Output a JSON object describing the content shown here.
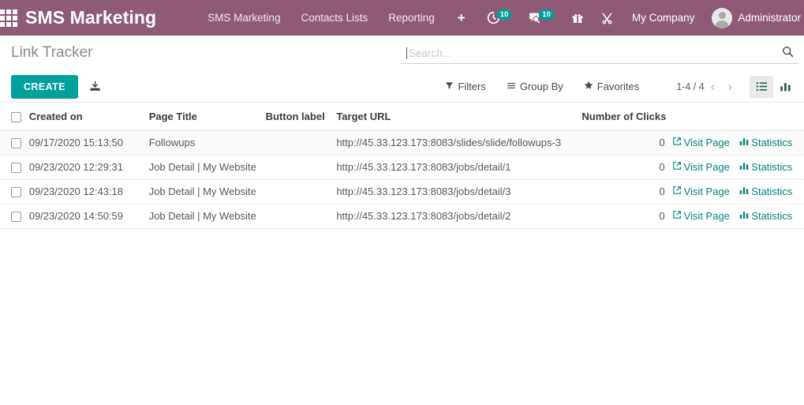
{
  "navbar": {
    "apps_icon": "apps-grid-icon",
    "brand": "SMS Marketing",
    "menu": [
      {
        "label": "SMS Marketing"
      },
      {
        "label": "Contacts Lists"
      },
      {
        "label": "Reporting"
      },
      {
        "label": "+"
      }
    ],
    "systray": [
      {
        "icon": "activity-clock-icon",
        "badge": "10"
      },
      {
        "icon": "messages-chat-icon",
        "badge": "10"
      },
      {
        "icon": "gift-box-icon",
        "badge": ""
      },
      {
        "icon": "tools-wrench-icon",
        "badge": ""
      }
    ],
    "company": "My Company",
    "user": "Administrator",
    "avatar_icon": "user-avatar-icon",
    "accent_color": "#8f5a76",
    "badge_color": "#00a09d"
  },
  "control_panel": {
    "breadcrumb": "Link Tracker",
    "create_label": "CREATE",
    "import_icon": "import-download-icon",
    "search": {
      "placeholder": "Search...",
      "value": "",
      "icon": "search-magnifier-icon"
    },
    "filters_label": "Filters",
    "groupby_label": "Group By",
    "favorites_label": "Favorites",
    "filters_icon": "funnel-filter-icon",
    "groupby_icon": "hamburger-lines-icon",
    "favorites_icon": "star-icon",
    "pager": {
      "range": "1-4 / 4",
      "prev_icon": "chevron-left-icon",
      "next_icon": "chevron-right-icon"
    },
    "views": [
      {
        "name": "list-view",
        "icon": "list-view-icon",
        "active": true
      },
      {
        "name": "graph-view",
        "icon": "bar-chart-view-icon",
        "active": false
      }
    ]
  },
  "table": {
    "columns": [
      {
        "key": "created_on",
        "label": "Created on"
      },
      {
        "key": "page_title",
        "label": "Page Title"
      },
      {
        "key": "button_label",
        "label": "Button label"
      },
      {
        "key": "target_url",
        "label": "Target URL"
      },
      {
        "key": "number_of_clicks",
        "label": "Number of Clicks"
      }
    ],
    "action_labels": {
      "visit": "Visit Page",
      "stats": "Statistics",
      "visit_icon": "external-link-icon",
      "stats_icon": "bar-chart-icon"
    },
    "link_color": "#00857e",
    "rows": [
      {
        "created_on": "09/17/2020 15:13:50",
        "page_title": "Followups",
        "button_label": "",
        "target_url": "http://45.33.123.173:8083/slides/slide/followups-3",
        "number_of_clicks": "0"
      },
      {
        "created_on": "09/23/2020 12:29:31",
        "page_title": "Job Detail | My Website",
        "button_label": "",
        "target_url": "http://45.33.123.173:8083/jobs/detail/1",
        "number_of_clicks": "0"
      },
      {
        "created_on": "09/23/2020 12:43:18",
        "page_title": "Job Detail | My Website",
        "button_label": "",
        "target_url": "http://45.33.123.173:8083/jobs/detail/3",
        "number_of_clicks": "0"
      },
      {
        "created_on": "09/23/2020 14:50:59",
        "page_title": "Job Detail | My Website",
        "button_label": "",
        "target_url": "http://45.33.123.173:8083/jobs/detail/2",
        "number_of_clicks": "0"
      }
    ]
  }
}
